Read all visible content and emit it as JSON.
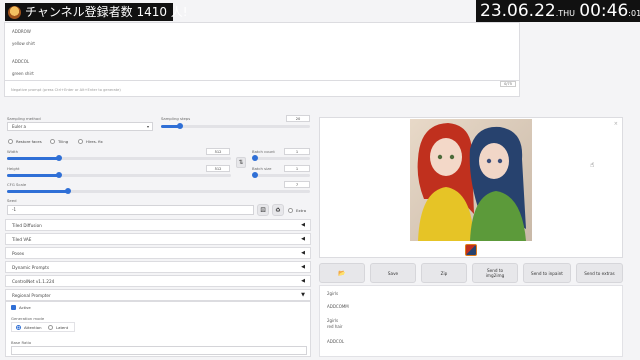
{
  "banner": {
    "text": "チャンネル登録者数 1410 人!"
  },
  "clock": {
    "date": "23.06.22",
    "dow": ".THU",
    "hm": "00:46",
    "sec": ":01"
  },
  "prompt": {
    "lines": [
      "ADDROW",
      "yellow shirt",
      "ADDCOL",
      "green shirt"
    ],
    "token_count": "0/75",
    "negative_placeholder": "Negative prompt (press Ctrl+Enter or Alt+Enter to generate)"
  },
  "sampling": {
    "method_label": "Sampling method",
    "method_value": "Euler a",
    "steps_label": "Sampling steps",
    "steps_value": "20",
    "steps_fraction": 0.13
  },
  "checks": {
    "restore_faces": "Restore faces",
    "tiling": "Tiling",
    "hires_fix": "Hires. fix"
  },
  "size": {
    "width_label": "Width",
    "width_value": "512",
    "width_fraction": 0.23,
    "height_label": "Height",
    "height_value": "512",
    "height_fraction": 0.23,
    "swap_icon": "swap-icon",
    "batch_count_label": "Batch count",
    "batch_count_value": "1",
    "batch_size_label": "Batch size",
    "batch_size_value": "1"
  },
  "cfg": {
    "label": "CFG Scale",
    "value": "7",
    "fraction": 0.2
  },
  "seed": {
    "label": "Seed",
    "value": "-1",
    "extra_label": "Extra"
  },
  "accordions": [
    {
      "label": "Tiled Diffusion"
    },
    {
      "label": "Tiled VAE"
    },
    {
      "label": "Posex"
    },
    {
      "label": "Dynamic Prompts"
    },
    {
      "label": "ControlNet v1.1.224"
    },
    {
      "label": "Regional Prompter"
    }
  ],
  "regional": {
    "active_label": "Active",
    "mode_label": "Generation mode",
    "mode_attention": "Attention",
    "mode_latent": "Latent",
    "base_ratio_label": "Base Ratio"
  },
  "buttons": {
    "folder_icon": "folder-icon",
    "save": "Save",
    "zip": "Zip",
    "send_img2img": "Send to img2img",
    "send_inpaint": "Send to inpaint",
    "send_extras": "Send to extras"
  },
  "info": {
    "lines": [
      "2girls",
      "ADDCOMM",
      "2girls",
      "red hair",
      "ADDCOL"
    ]
  },
  "colors": {
    "accent": "#2f6fd6",
    "background": "#f4f4f6"
  }
}
